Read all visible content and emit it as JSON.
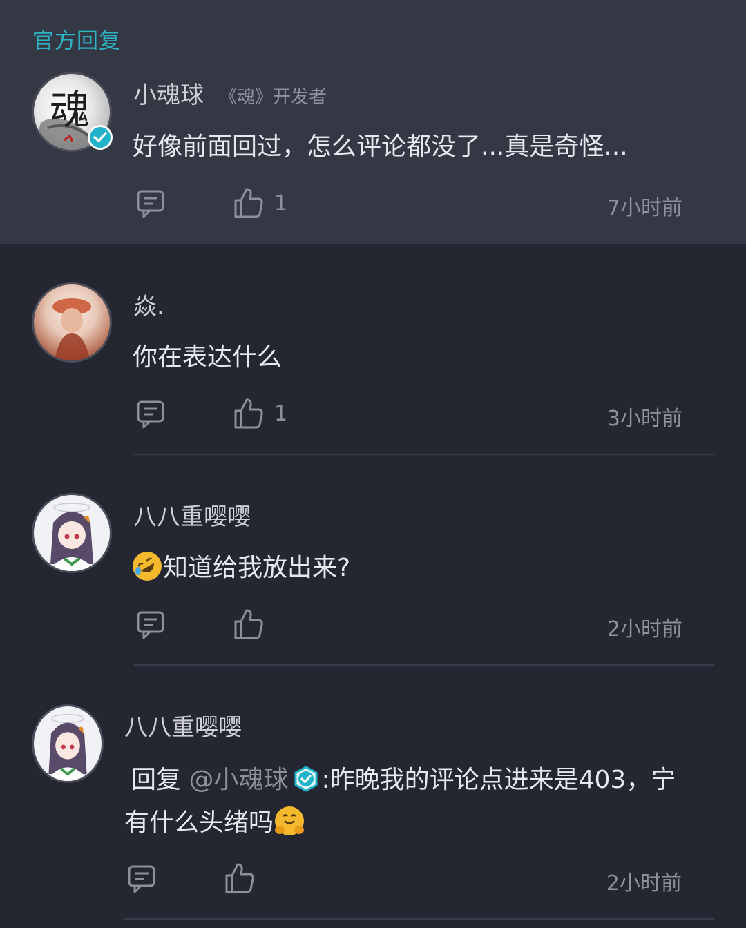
{
  "section": {
    "title": "官方回复"
  },
  "comments": [
    {
      "username": "小魂球",
      "tag": "《魂》开发者",
      "text": "好像前面回过，怎么评论都没了...真是奇怪...",
      "likes": "1",
      "time": "7小时前",
      "avatar_char": "魂",
      "verified": true
    },
    {
      "username": "焱.",
      "text": "你在表达什么",
      "likes": "1",
      "time": "3小时前"
    },
    {
      "username": "八八重嘤嘤",
      "text": "知道给我放出来?",
      "likes": "",
      "time": "2小时前"
    },
    {
      "username": "八八重嘤嘤",
      "reply_prefix": "回复",
      "mention": "@小魂球",
      "text_line1": ":昨晚我的评论点进来是403，宁",
      "text_line2": "有什么头绪吗",
      "likes": "",
      "time": "2小时前"
    }
  ],
  "colors": {
    "accent": "#2eb3c4",
    "background": "#242631",
    "official_background": "#343844"
  }
}
